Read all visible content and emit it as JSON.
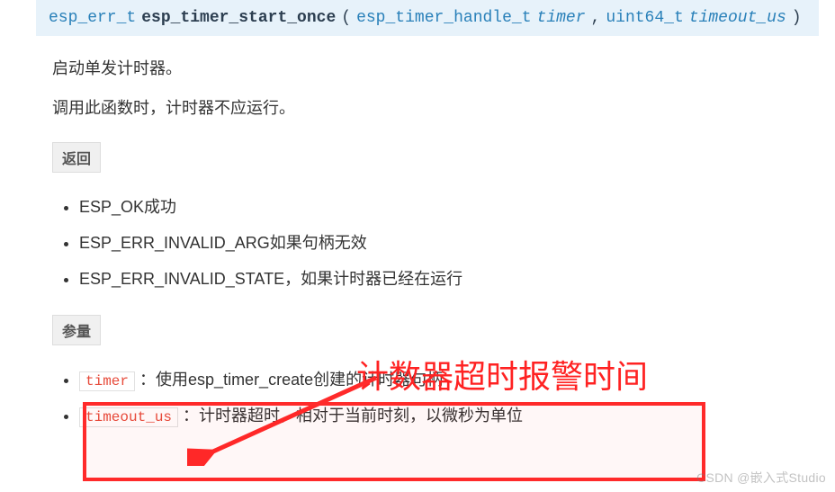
{
  "signature": {
    "return_type": "esp_err_t",
    "name": "esp_timer_start_once",
    "open": "(",
    "params": [
      {
        "type": "esp_timer_handle_t",
        "name": "timer",
        "sep": ","
      },
      {
        "type": "uint64_t",
        "name": "timeout_us",
        "sep": ""
      }
    ],
    "close": ")"
  },
  "description": {
    "line1": "启动单发计时器。",
    "line2": "调用此函数时，计时器不应运行。"
  },
  "returns": {
    "label": "返回",
    "items": [
      "ESP_OK成功",
      "ESP_ERR_INVALID_ARG如果句柄无效",
      "ESP_ERR_INVALID_STATE，如果计时器已经在运行"
    ]
  },
  "params": {
    "label": "参量",
    "items": [
      {
        "name": "timer",
        "desc": "：使用esp_timer_create创建的计时器句柄"
      },
      {
        "name": "timeout_us",
        "desc": "：计时器超时，相对于当前时刻，以微秒为单位"
      }
    ]
  },
  "annotation": {
    "text": "计数器超时报警时间"
  },
  "watermark": "CSDN @嵌入式Studio"
}
